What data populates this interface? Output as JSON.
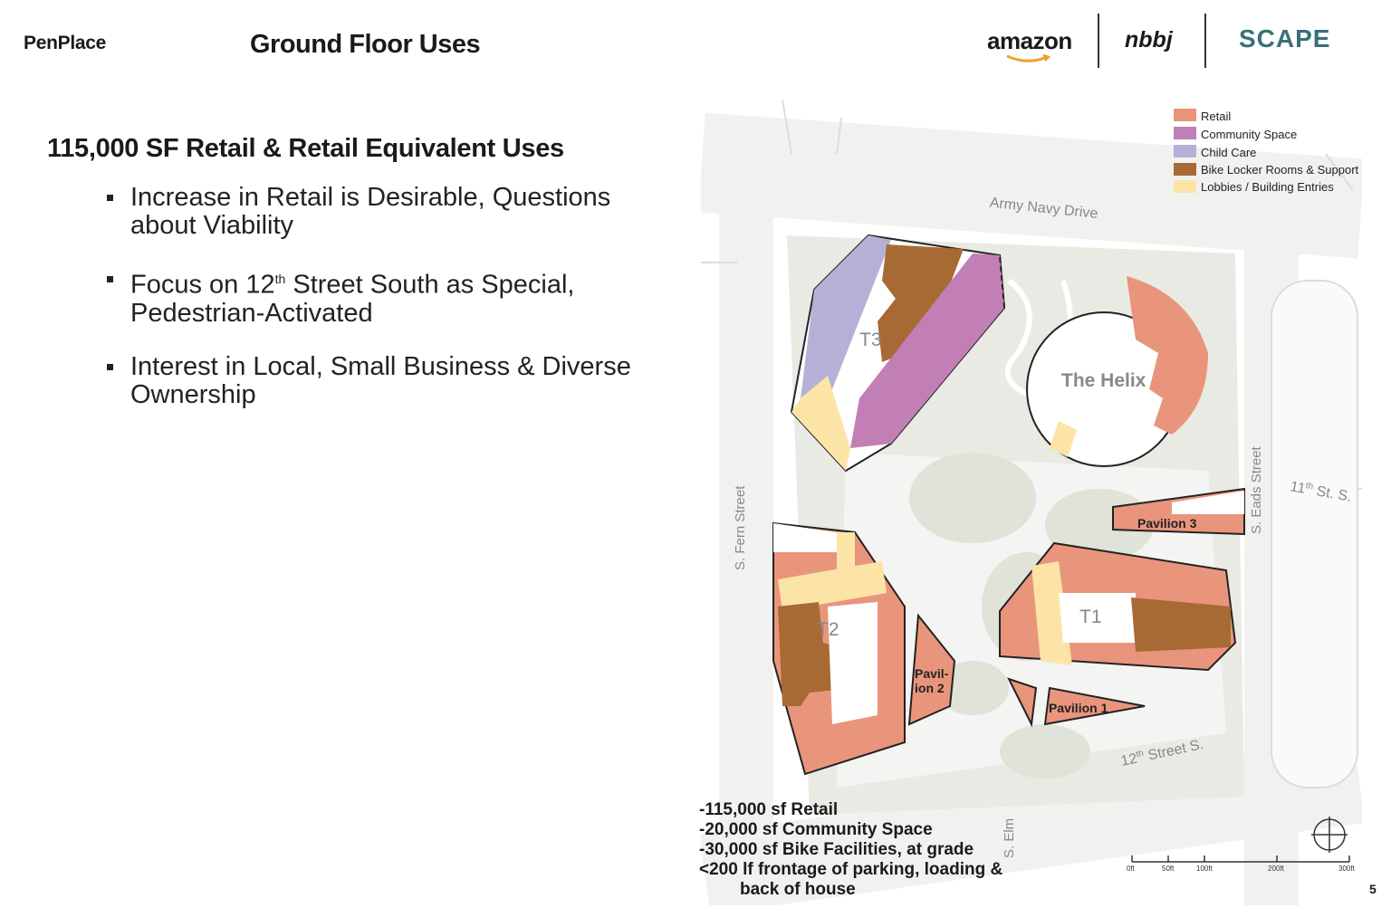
{
  "header": {
    "brand": "PenPlace",
    "title": "Ground Floor Uses",
    "logos": {
      "amazon": "amazon",
      "nbbj": "nbbj",
      "scape": "SCAPE"
    }
  },
  "content": {
    "headline": "115,000 SF Retail & Retail Equivalent Uses",
    "bullets": [
      {
        "line1": "Increase in Retail is Desirable, Questions",
        "line2": "about Viability"
      },
      {
        "pre": "Focus on 12",
        "sup": "th",
        "post": " Street South as Special,",
        "line2": "Pedestrian-Activated"
      },
      {
        "line1": "Interest in Local, Small Business & Diverse",
        "line2": "Ownership"
      }
    ]
  },
  "legend": [
    {
      "label": "Retail",
      "color": "#e9957b"
    },
    {
      "label": "Community Space",
      "color": "#c17fb5"
    },
    {
      "label": "Child Care",
      "color": "#b7b0d6"
    },
    {
      "label": "Bike Locker Rooms & Support",
      "color": "#a86a34"
    },
    {
      "label": "Lobbies / Building Entries",
      "color": "#fbe4a6"
    }
  ],
  "map_labels": {
    "army_navy": "Army Navy Drive",
    "fern": "S. Fern Street",
    "eads": "S. Eads Street",
    "eleventh_pre": "11",
    "eleventh_sup": "th",
    "eleventh_post": " St. S.",
    "twelfth_pre": "12",
    "twelfth_sup": "th",
    "twelfth_post": " Street S.",
    "elm": "S. Elm",
    "t3": "T3",
    "t2": "T2",
    "t1": "T1",
    "helix": "The Helix",
    "pavilion1": "Pavilion 1",
    "pavilion2_a": "Pavil-",
    "pavilion2_b": "ion 2",
    "pavilion3": "Pavilion 3"
  },
  "stats": [
    "-115,000 sf Retail",
    "-20,000 sf Community Space",
    "-30,000 sf Bike Facilities, at grade",
    "<200 lf frontage of parking, loading &",
    "back of house"
  ],
  "scale": [
    "0ft",
    "50ft",
    "100ft",
    "200ft",
    "300ft"
  ],
  "page_number": "5"
}
